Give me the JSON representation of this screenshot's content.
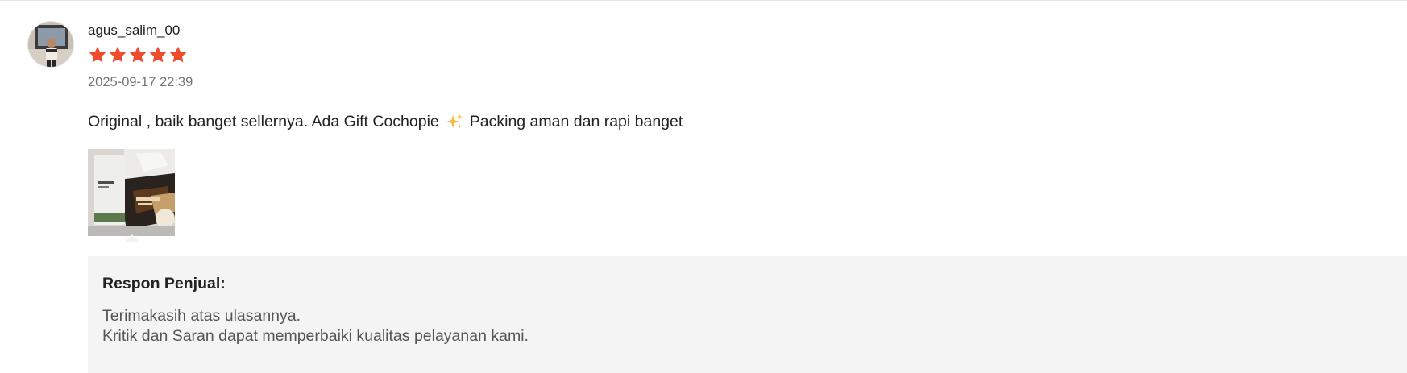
{
  "review": {
    "username": "agus_salim_00",
    "rating": 5,
    "rating_max": 5,
    "timestamp": "2025-09-17 22:39",
    "comment_part1": "Original , baik banget sellernya. Ada Gift Cochopie",
    "comment_emoji": "sparkles-emoji",
    "comment_part2": "Packing aman dan rapi banget",
    "media_count": 1
  },
  "seller_response": {
    "title": "Respon Penjual:",
    "line1": "Terimakasih atas ulasannya.",
    "line2": "Kritik dan Saran dapat memperbaiki kualitas pelayanan kami."
  },
  "colors": {
    "star": "#ee4d2d",
    "response_bg": "#f4f4f4",
    "text_primary": "#222222",
    "text_secondary": "#757575"
  }
}
